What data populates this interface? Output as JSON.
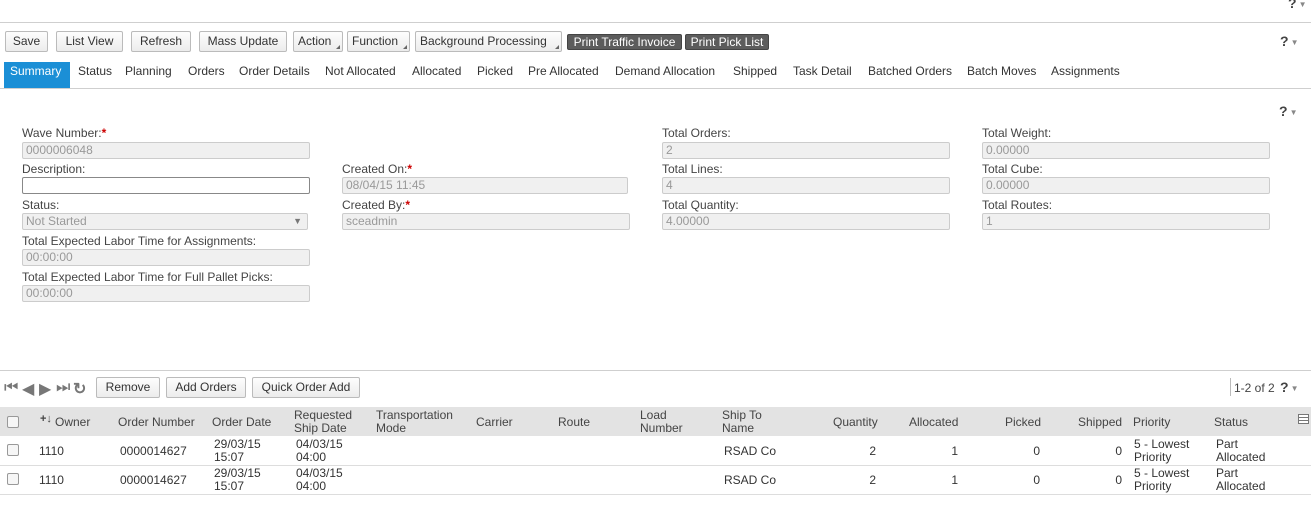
{
  "help": {
    "label": "?"
  },
  "toolbar": {
    "save": "Save",
    "list_view": "List View",
    "refresh": "Refresh",
    "mass_update": "Mass Update",
    "action": "Action",
    "function": "Function",
    "background_processing": "Background Processing",
    "print_traffic_invoice": "Print Traffic Invoice",
    "print_pick_list": "Print Pick List"
  },
  "tabs": [
    "Summary",
    "Status",
    "Planning",
    "Orders",
    "Order Details",
    "Not Allocated",
    "Allocated",
    "Picked",
    "Pre Allocated",
    "Demand Allocation",
    "Shipped",
    "Task Detail",
    "Batched Orders",
    "Batch Moves",
    "Assignments"
  ],
  "form": {
    "wave_number": {
      "label": "Wave Number:",
      "value": "0000006048"
    },
    "description": {
      "label": "Description:",
      "value": ""
    },
    "status": {
      "label": "Status:",
      "value": "Not Started"
    },
    "labor_assign": {
      "label": "Total Expected Labor Time for Assignments:",
      "value": "00:00:00"
    },
    "labor_pallet": {
      "label": "Total Expected Labor Time for Full Pallet Picks:",
      "value": "00:00:00"
    },
    "created_on": {
      "label": "Created On:",
      "value": "08/04/15 11:45"
    },
    "created_by": {
      "label": "Created By:",
      "value": "sceadmin"
    },
    "total_orders": {
      "label": "Total Orders:",
      "value": "2"
    },
    "total_lines": {
      "label": "Total Lines:",
      "value": "4"
    },
    "total_quantity": {
      "label": "Total Quantity:",
      "value": "4.00000"
    },
    "total_weight": {
      "label": "Total Weight:",
      "value": "0.00000"
    },
    "total_cube": {
      "label": "Total Cube:",
      "value": "0.00000"
    },
    "total_routes": {
      "label": "Total Routes:",
      "value": "1"
    },
    "required_mark": "*"
  },
  "grid": {
    "remove": "Remove",
    "add_orders": "Add Orders",
    "quick_order_add": "Quick Order Add",
    "paging": "1-2 of 2",
    "sort_icon": "+↓",
    "columns": {
      "owner": "Owner",
      "order_number": "Order Number",
      "order_date": "Order Date",
      "req_ship_1": "Requested",
      "req_ship_2": "Ship Date",
      "transport_1": "Transportation",
      "transport_2": "Mode",
      "carrier": "Carrier",
      "route": "Route",
      "load_1": "Load",
      "load_2": "Number",
      "shipto_1": "Ship To",
      "shipto_2": "Name",
      "quantity": "Quantity",
      "allocated": "Allocated",
      "picked": "Picked",
      "shipped": "Shipped",
      "priority": "Priority",
      "status": "Status"
    },
    "rows": [
      {
        "owner": "1110",
        "order_number": "0000014627",
        "order_date_1": "29/03/15",
        "order_date_2": "15:07",
        "ship_date_1": "04/03/15",
        "ship_date_2": "04:00",
        "ship_to": "RSAD Co",
        "quantity": "2",
        "allocated": "1",
        "picked": "0",
        "shipped": "0",
        "priority_1": "5 - Lowest",
        "priority_2": "Priority",
        "status_1": "Part",
        "status_2": "Allocated"
      },
      {
        "owner": "1110",
        "order_number": "0000014627",
        "order_date_1": "29/03/15",
        "order_date_2": "15:07",
        "ship_date_1": "04/03/15",
        "ship_date_2": "04:00",
        "ship_to": "RSAD Co",
        "quantity": "2",
        "allocated": "1",
        "picked": "0",
        "shipped": "0",
        "priority_1": "5 - Lowest",
        "priority_2": "Priority",
        "status_1": "Part",
        "status_2": "Allocated"
      }
    ]
  }
}
